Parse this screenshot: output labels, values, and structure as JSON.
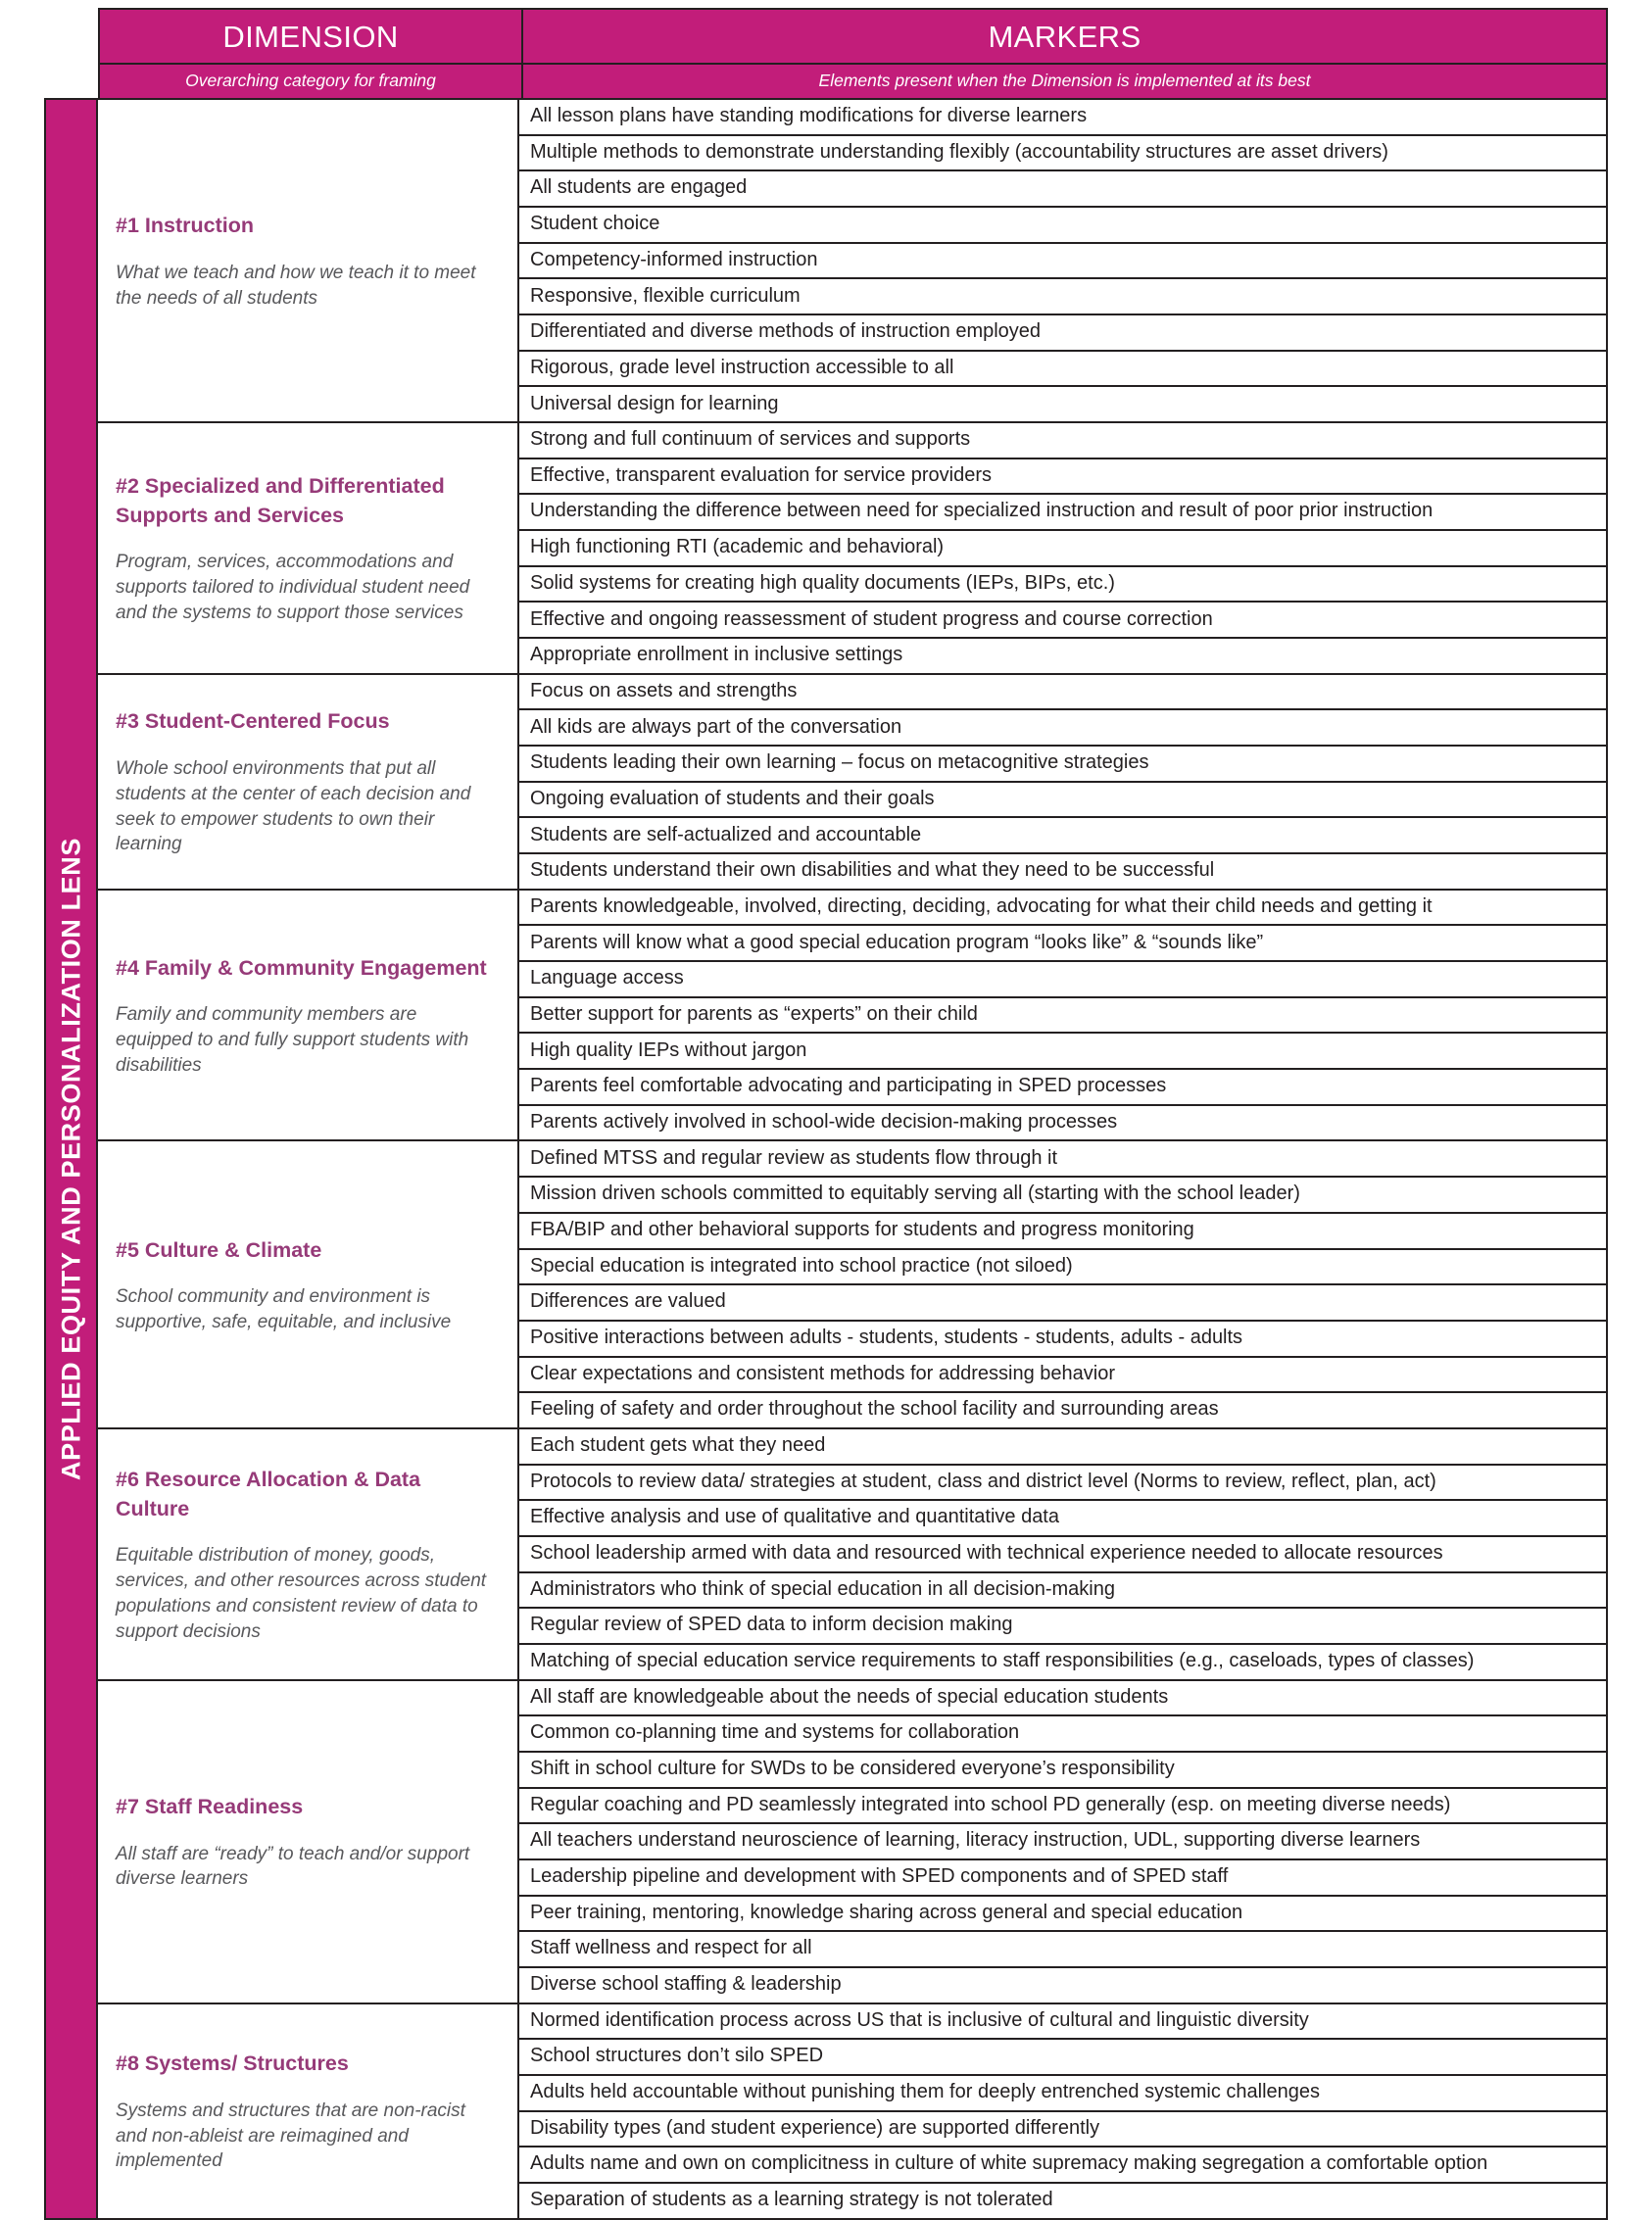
{
  "header": {
    "dimension_title": "DIMENSION",
    "markers_title": "MARKERS",
    "dimension_subtitle": "Overarching category for framing",
    "markers_subtitle": "Elements present when the Dimension is implemented at its best"
  },
  "lens": {
    "label": "APPLIED EQUITY AND PERSONALIZATION LENS"
  },
  "colors": {
    "header_pink": "#c21d7a",
    "lens_pink": "#c21d7a",
    "dimension_heading": "#963a78",
    "dimension_description": "#58585b",
    "border": "#231f20",
    "marker_text": "#231f20"
  },
  "sections": [
    {
      "name": "#1 Instruction",
      "description": "What we teach and how we teach it to meet the needs of all students",
      "markers": [
        "All lesson plans have standing modifications for diverse learners",
        "Multiple methods to demonstrate understanding flexibly (accountability structures are asset drivers)",
        "All students are engaged",
        "Student choice",
        "Competency-informed instruction",
        "Responsive, flexible curriculum",
        "Differentiated and diverse methods of instruction employed",
        "Rigorous, grade level instruction accessible to all",
        "Universal design for learning"
      ]
    },
    {
      "name": "#2 Specialized and Differentiated Supports and Services",
      "description": "Program, services, accommodations and supports tailored to individual student need and the systems to support those services",
      "markers": [
        "Strong and full continuum of services and supports",
        "Effective, transparent evaluation for service providers",
        "Understanding the difference between need for specialized instruction and result of poor prior instruction",
        "High functioning RTI (academic and behavioral)",
        "Solid systems for creating high quality documents (IEPs, BIPs, etc.)",
        "Effective and ongoing reassessment of student progress and course correction",
        "Appropriate enrollment in inclusive settings"
      ]
    },
    {
      "name": "#3 Student-Centered Focus",
      "description": "Whole school environments that put all students at the center of each decision and seek to empower students to own their learning",
      "markers": [
        "Focus on assets and strengths",
        "All kids are always part of the conversation",
        "Students leading their own learning – focus on metacognitive strategies",
        "Ongoing evaluation of students and their goals",
        "Students are self-actualized and accountable",
        "Students understand their own disabilities and what they need to be successful"
      ]
    },
    {
      "name": "#4 Family & Community Engagement",
      "description": "Family and community members are equipped to and fully support students with disabilities",
      "markers": [
        "Parents knowledgeable, involved, directing, deciding, advocating for what their child needs and getting it",
        "Parents will know what a good special education program “looks like” & “sounds like”",
        "Language access",
        "Better support for parents as “experts” on their child",
        "High quality IEPs without jargon",
        "Parents feel comfortable advocating and participating in SPED processes",
        "Parents actively involved in school-wide decision-making processes"
      ]
    },
    {
      "name": "#5 Culture & Climate",
      "description": "School community and environment is supportive, safe, equitable, and inclusive",
      "markers": [
        "Defined MTSS and regular review as students flow through it",
        "Mission driven schools committed to equitably serving all (starting with the school leader)",
        "FBA/BIP and other behavioral supports for students and progress monitoring",
        "Special education is integrated into school practice (not siloed)",
        "Differences are valued",
        "Positive interactions between adults - students, students - students, adults - adults",
        "Clear expectations and consistent methods for addressing behavior",
        "Feeling of safety and order throughout the school facility and surrounding areas"
      ]
    },
    {
      "name": "#6 Resource Allocation & Data Culture",
      "description": "Equitable distribution of money, goods, services, and other resources across student populations and consistent review of data to support decisions",
      "markers": [
        "Each student gets what they need",
        "Protocols to review data/ strategies at student, class and district level (Norms to review, reflect, plan, act)",
        "Effective analysis and use of qualitative and quantitative data",
        "School leadership armed with data and resourced with technical experience needed to allocate resources",
        "Administrators who think of special education in all decision-making",
        "Regular review of SPED data to inform decision making",
        "Matching of special education service requirements to staff responsibilities  (e.g., caseloads, types of classes)"
      ]
    },
    {
      "name": "#7 Staff Readiness",
      "description": "All staff are “ready” to teach and/or support diverse learners",
      "markers": [
        "All staff are knowledgeable about the needs of special education students",
        "Common co-planning time and systems for collaboration",
        "Shift in school culture for SWDs to be considered everyone’s responsibility",
        "Regular coaching and PD seamlessly integrated into school PD generally (esp. on meeting diverse needs)",
        "All teachers understand neuroscience of learning, literacy instruction, UDL, supporting diverse learners",
        "Leadership pipeline and development with SPED components and of SPED staff",
        "Peer training, mentoring, knowledge sharing across general and special education",
        "Staff wellness and respect for all",
        "Diverse school staffing & leadership"
      ]
    },
    {
      "name": "#8 Systems/ Structures",
      "description": "Systems and structures that are non-racist and non-ableist are reimagined and implemented",
      "markers": [
        "Normed identification process across US that is inclusive of cultural and linguistic diversity",
        "School structures don’t silo SPED",
        "Adults held accountable without punishing them for deeply entrenched systemic challenges",
        "Disability types (and student experience) are supported differently",
        "Adults name and own on complicitness in culture of white supremacy making segregation a comfortable option",
        "Separation of students as a learning strategy is not tolerated"
      ]
    }
  ]
}
